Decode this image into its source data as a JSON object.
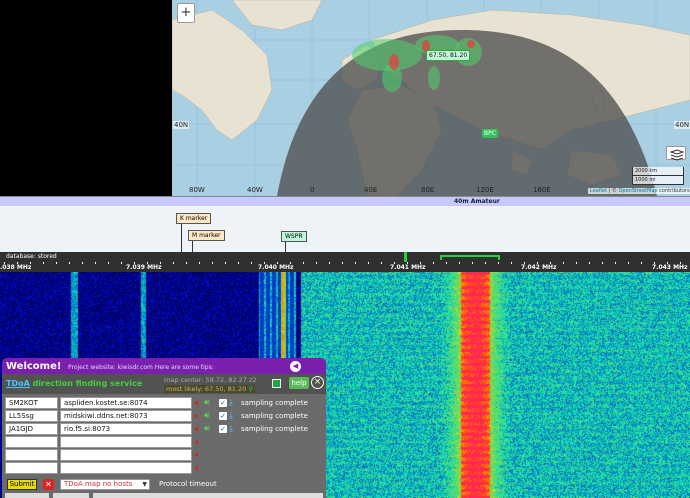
{
  "map": {
    "zoom_in": "+",
    "zoom_out": "−",
    "lat_labels": [
      "40N",
      "40N"
    ],
    "lon_labels": [
      "80W",
      "40W",
      "0",
      "40E",
      "80E",
      "120E",
      "160E"
    ],
    "peak_marker": "67.50, 81.20",
    "bpc_marker": "BPC",
    "scale_km": "2000 km",
    "scale_mi": "1000 mi",
    "attribution_leaflet": "Leaflet",
    "attribution_sep": " | © ",
    "attribution_osm": "OpenStreetMap",
    "attribution_tail": " contributors"
  },
  "band": {
    "name": "40m Amateur"
  },
  "dx_labels": [
    {
      "label": "K marker",
      "bg": "#fde7c4"
    },
    {
      "label": "M marker",
      "bg": "#fde7c4"
    },
    {
      "label": "WSPR",
      "bg": "#bff5d9"
    }
  ],
  "scale": {
    "database": "database: stored",
    "freqs": [
      ".038 MHz",
      "7.039 MHz",
      "7.040 MHz",
      "7.041 MHz",
      "7.042 MHz",
      "7.043 MHz"
    ]
  },
  "panel": {
    "welcome": "Welcome!",
    "project": "Project website: kiwisdr.com   Here are some tips:",
    "tdoa_title": "TDoA",
    "tdoa_subtitle": " direction finding service",
    "map_center": "map center: 58.72, 82.27 z2",
    "most_likely": "most likely: 67.50, 81.20",
    "help": "help",
    "close": "×",
    "hosts": [
      {
        "id": "SM2KOT",
        "host": "aspliden.kostet.se:8074",
        "status": "sampling complete"
      },
      {
        "id": "LL5Ssg",
        "host": "midskiwi.ddns.net:8073",
        "status": "sampling complete"
      },
      {
        "id": "JA1GJD",
        "host": "rio.f5.si:8073",
        "status": "sampling complete"
      },
      {
        "id": "",
        "host": "",
        "status": ""
      },
      {
        "id": "",
        "host": "",
        "status": ""
      },
      {
        "id": "",
        "host": "",
        "status": ""
      }
    ],
    "submit": "Submit",
    "map_select": "TDoA map no hosts",
    "protocol_timeout": "Protocol timeout"
  },
  "colors": {
    "panel_title_bg": "#7a1fae",
    "help_bg": "#5cb85c",
    "submit_bg": "#e6dc00"
  }
}
